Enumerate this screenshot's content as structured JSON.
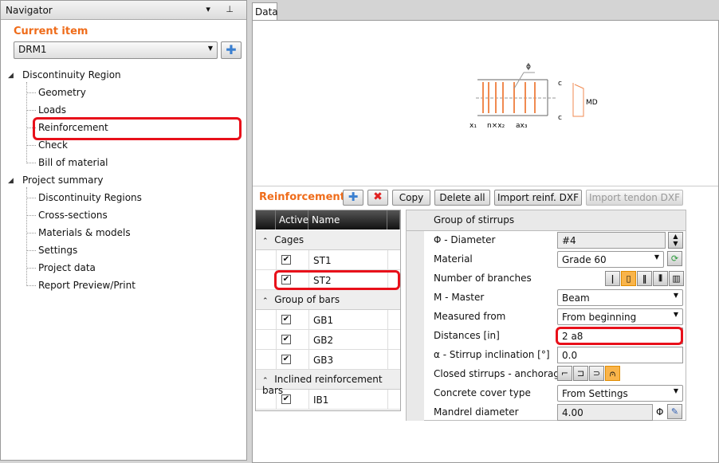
{
  "navigator": {
    "title": "Navigator",
    "pin_icon": "pin-icon",
    "current_item_label": "Current item",
    "current_item_value": "DRM1",
    "tree": [
      {
        "label": "Discontinuity Region",
        "children": [
          "Geometry",
          "Loads",
          "Reinforcement",
          "Check",
          "Bill of material"
        ]
      },
      {
        "label": "Project summary",
        "children": [
          "Discontinuity Regions",
          "Cross-sections",
          "Materials & models",
          "Settings",
          "Project data",
          "Report Preview/Print"
        ]
      }
    ],
    "selected": "Reinforcement"
  },
  "tab": {
    "label": "Data"
  },
  "diagram": {
    "phi": "ϕ",
    "c_top": "c",
    "c_bottom": "c",
    "md": "MD",
    "x1": "x₁",
    "nx2": "n×x₂",
    "ax3": "ax₃"
  },
  "reinforcement": {
    "title": "Reinforcement",
    "copy": "Copy",
    "delete_all": "Delete all",
    "import_reinf": "Import reinf. DXF",
    "import_tendon": "Import tendon DXF"
  },
  "table": {
    "headers": [
      "Active",
      "Name"
    ],
    "groups": [
      {
        "label": "Cages",
        "rows": [
          {
            "name": "ST1",
            "active": true
          },
          {
            "name": "ST2",
            "active": true
          }
        ]
      },
      {
        "label": "Group of bars",
        "rows": [
          {
            "name": "GB1",
            "active": true
          },
          {
            "name": "GB2",
            "active": true
          },
          {
            "name": "GB3",
            "active": true
          }
        ]
      },
      {
        "label": "Inclined reinforcement bars",
        "rows": [
          {
            "name": "IB1",
            "active": true
          }
        ]
      }
    ]
  },
  "props": {
    "header": "Group of stirrups",
    "diameter_label": "Φ - Diameter",
    "diameter": "#4",
    "material_label": "Material",
    "material": "Grade 60",
    "branches_label": "Number of branches",
    "master_label": "M - Master",
    "master": "Beam",
    "measured_label": "Measured from",
    "measured": "From beginning",
    "distances_label": "Distances [in]",
    "distances": "2 a8",
    "incl_label": "α - Stirrup inclination [°]",
    "incl": "0.0",
    "anchorage_label": "Closed stirrups - anchorage",
    "cover_label": "Concrete cover type",
    "cover": "From Settings",
    "mandrel_label": "Mandrel diameter",
    "mandrel": "4.00",
    "mandrel_unit": "Φ"
  }
}
